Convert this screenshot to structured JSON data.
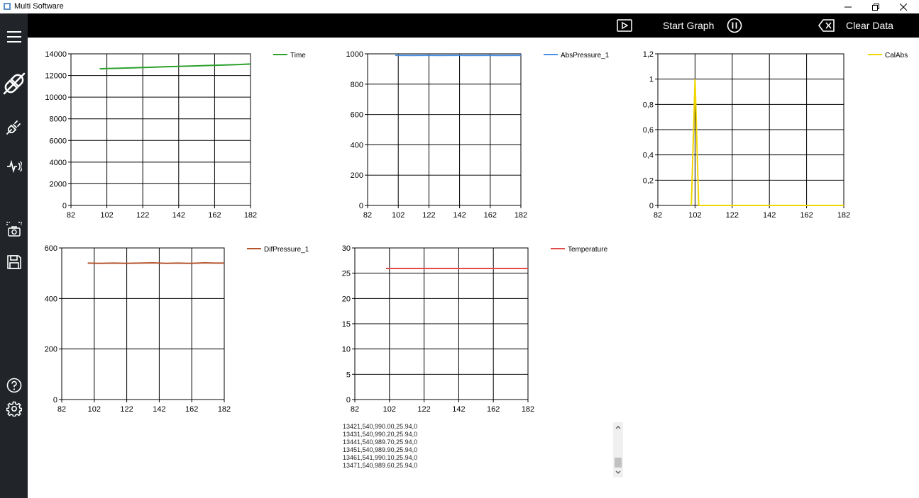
{
  "window": {
    "title": "Multi Software"
  },
  "toolbar": {
    "start_label": "Start Graph",
    "clear_label": "Clear Data"
  },
  "sidebar": {
    "top_icons": [
      "menu-icon",
      "disconnect-icon",
      "plug-icon",
      "signal-icon"
    ],
    "mid_icons": [
      "screenshot-icon",
      "save-icon"
    ],
    "bottom_icons": [
      "help-icon",
      "settings-icon"
    ]
  },
  "charts": [
    {
      "id": "time",
      "series": "Time",
      "color": "#2ca02c",
      "xlim": [
        82,
        182
      ],
      "xticks": [
        82,
        102,
        122,
        142,
        162,
        182
      ],
      "ylim": [
        0,
        14000
      ],
      "yticks": [
        "0",
        "2000",
        "4000",
        "6000",
        "8000",
        "10000",
        "12000",
        "14000"
      ],
      "ytick_values": [
        0,
        2000,
        4000,
        6000,
        8000,
        10000,
        12000,
        14000
      ],
      "x": [
        98,
        102,
        110,
        118,
        126,
        134,
        142,
        150,
        158,
        166,
        174,
        182
      ],
      "y": [
        12620,
        12640,
        12680,
        12720,
        12760,
        12800,
        12840,
        12880,
        12920,
        12960,
        13000,
        13060
      ]
    },
    {
      "id": "abs",
      "series": "AbsPressure_1",
      "color": "#4a90e2",
      "xlim": [
        82,
        182
      ],
      "xticks": [
        82,
        102,
        122,
        142,
        162,
        182
      ],
      "ylim": [
        0,
        1000
      ],
      "yticks": [
        "0",
        "200",
        "400",
        "600",
        "800",
        "1000"
      ],
      "ytick_values": [
        0,
        200,
        400,
        600,
        800,
        1000
      ],
      "x": [
        100,
        110,
        120,
        130,
        140,
        150,
        160,
        170,
        182
      ],
      "y": [
        990,
        989.8,
        990.1,
        989.9,
        990,
        989.7,
        990.2,
        989.9,
        990
      ]
    },
    {
      "id": "calabs",
      "series": "CalAbs",
      "color": "#f2d600",
      "xlim": [
        82,
        182
      ],
      "xticks": [
        82,
        102,
        122,
        142,
        162,
        182
      ],
      "ylim": [
        0,
        1.2
      ],
      "yticks": [
        "0",
        "0,2",
        "0,4",
        "0,6",
        "0,8",
        "1",
        "1,2"
      ],
      "ytick_values": [
        0,
        0.2,
        0.4,
        0.6,
        0.8,
        1,
        1.2
      ],
      "x": [
        100,
        102,
        104,
        110,
        120,
        182
      ],
      "y": [
        0,
        1,
        0,
        0,
        0,
        0
      ]
    },
    {
      "id": "dif",
      "series": "DifPressure_1",
      "color": "#b5542c",
      "xlim": [
        82,
        182
      ],
      "xticks": [
        82,
        102,
        122,
        142,
        162,
        182
      ],
      "ylim": [
        0,
        600
      ],
      "yticks": [
        "0",
        "200",
        "400",
        "600"
      ],
      "ytick_values": [
        0,
        200,
        400,
        600
      ],
      "x": [
        98,
        106,
        114,
        122,
        130,
        138,
        146,
        154,
        162,
        170,
        176,
        182
      ],
      "y": [
        540,
        539,
        540,
        539,
        540,
        541,
        539,
        540,
        539,
        541,
        540,
        540
      ]
    },
    {
      "id": "temp",
      "series": "Temperature",
      "color": "#e34b4b",
      "xlim": [
        82,
        182
      ],
      "xticks": [
        82,
        102,
        122,
        142,
        162,
        182
      ],
      "ylim": [
        0,
        30
      ],
      "yticks": [
        "0",
        "5",
        "10",
        "15",
        "20",
        "25",
        "30"
      ],
      "ytick_values": [
        0,
        5,
        10,
        15,
        20,
        25,
        30
      ],
      "x": [
        100,
        182
      ],
      "y": [
        25.94,
        25.94
      ]
    }
  ],
  "log_lines": [
    "13421,540,990.00,25.94,0",
    "13431,540,990.20,25.94,0",
    "13441,540,989.70,25.94,0",
    "13451,540,989.90,25.94,0",
    "13461,541,990.10,25.94,0",
    "13471,540,989.60,25.94,0"
  ]
}
